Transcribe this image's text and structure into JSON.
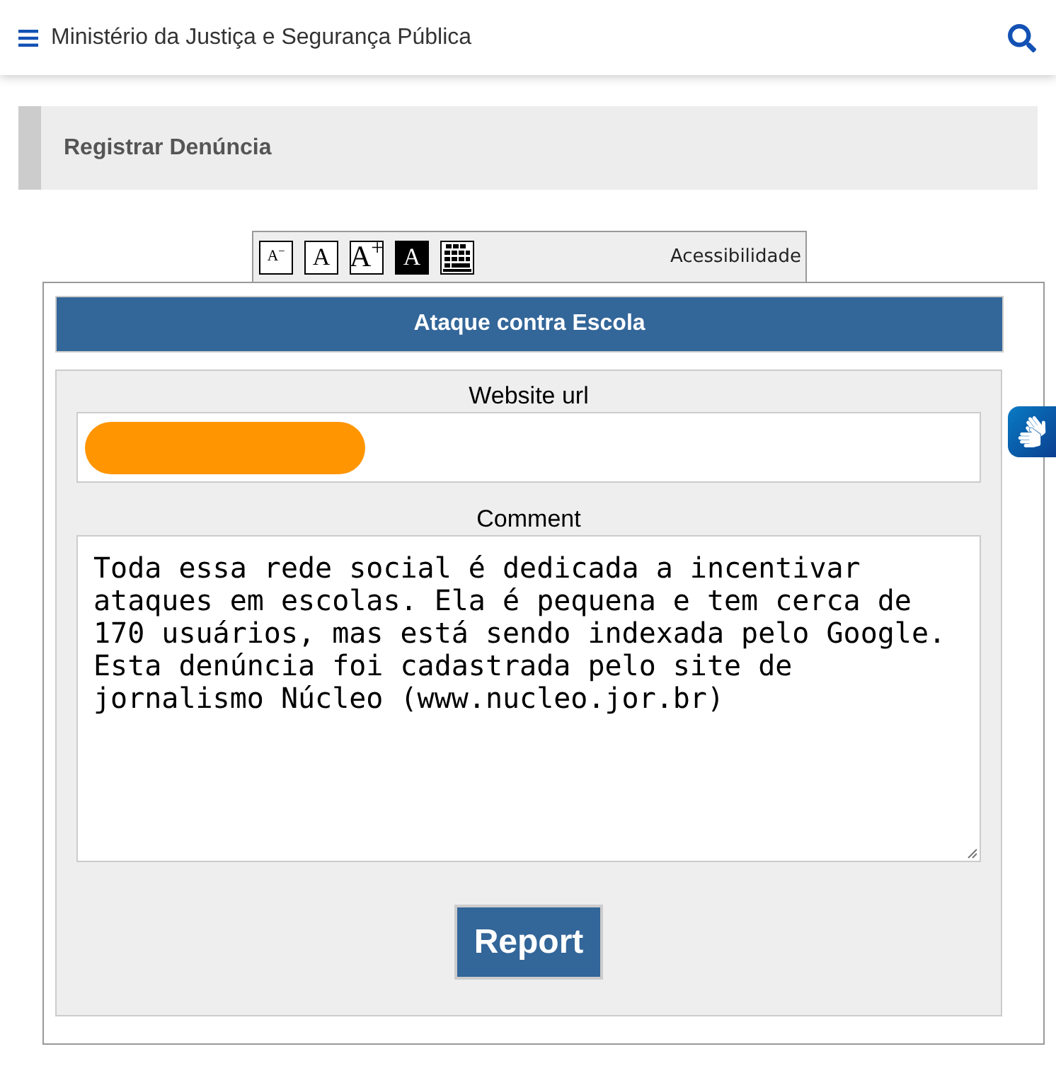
{
  "header": {
    "title": "Ministério da Justiça e Segurança Pública"
  },
  "breadcrumb": {
    "title": "Registrar Denúncia"
  },
  "accessibility_toolbar": {
    "buttons": [
      {
        "kind": "decrease",
        "label": "A$^{−}$"
      },
      {
        "kind": "normal",
        "label": "A"
      },
      {
        "kind": "increase",
        "label": "A$^{+}$"
      },
      {
        "kind": "contrast",
        "label": "A"
      },
      {
        "kind": "keyboard"
      }
    ],
    "label": "Acessibilidade"
  },
  "form": {
    "title": "Ataque contra Escola",
    "fields": [
      {
        "kind": "input",
        "label": "Website url",
        "redacted": true
      },
      {
        "kind": "textarea",
        "label": "Comment",
        "value": "Toda essa rede social é dedicada a incentivar ataques em escolas. Ela é pequena e tem cerca de 170 usuários, mas está sendo indexada pelo Google. Esta denúncia foi cadastrada pelo site de jornalismo Núcleo (www.nucleo.jor.br)"
      }
    ],
    "submit_button": "Report"
  }
}
